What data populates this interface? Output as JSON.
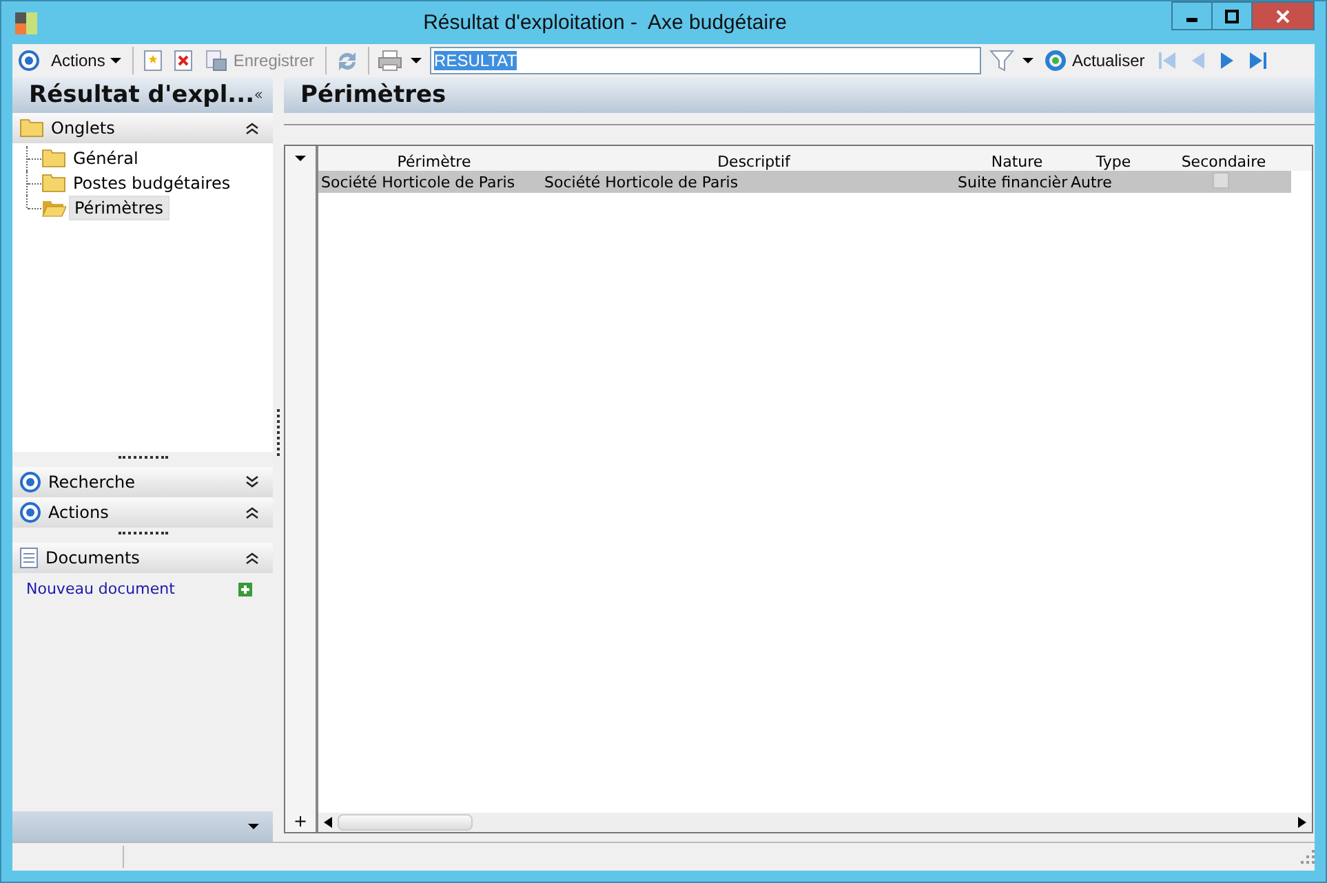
{
  "window": {
    "title": "Résultat d'exploitation -  Axe budgétaire"
  },
  "toolbar": {
    "actions_label": "Actions",
    "save_label": "Enregistrer",
    "search_value": "RESULTAT",
    "refresh_label": "Actualiser"
  },
  "sidebar": {
    "title": "Résultat d'expl...",
    "tabs_header": "Onglets",
    "tabs": [
      {
        "label": "Général",
        "selected": false
      },
      {
        "label": "Postes budgétaires",
        "selected": false
      },
      {
        "label": "Périmètres",
        "selected": true
      }
    ],
    "sections": [
      {
        "label": "Recherche",
        "kind": "target",
        "expanded": false
      },
      {
        "label": "Actions",
        "kind": "target",
        "expanded": true
      },
      {
        "label": "Documents",
        "kind": "doc",
        "expanded": true
      }
    ],
    "documents_link": "Nouveau document"
  },
  "main": {
    "title": "Périmètres",
    "table": {
      "add_row_label": "+",
      "columns": [
        "Périmètre",
        "Descriptif",
        "Nature",
        "Type",
        "Secondaire"
      ],
      "rows": [
        {
          "cells": [
            "Société Horticole de Paris",
            "Société Horticole de Paris",
            "Suite financièr",
            "Autre"
          ],
          "secondaire_checked": false,
          "selected": true
        }
      ]
    }
  }
}
